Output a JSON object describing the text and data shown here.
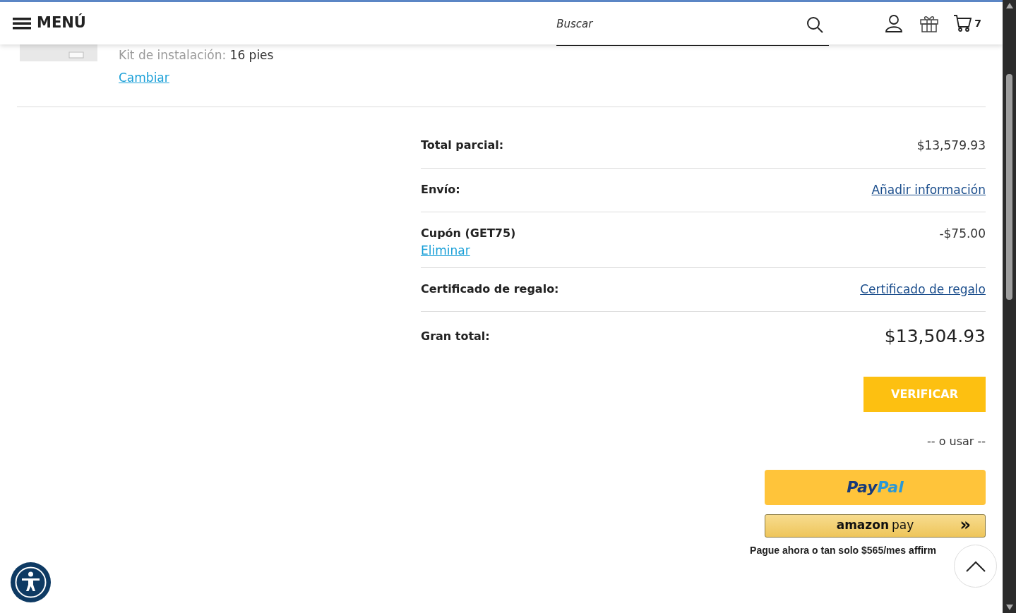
{
  "header": {
    "menu_label": "MENÚ",
    "search": {
      "placeholder": "Buscar"
    },
    "cart_count": "7"
  },
  "product": {
    "option_label": "Kit de instalación:",
    "option_value": "16 pies",
    "change_link": "Cambiar"
  },
  "summary": [
    {
      "kind": "amount",
      "label": "Total parcial:",
      "value": "$13,579.93"
    },
    {
      "kind": "link",
      "label": "Envío:",
      "value": "Añadir información"
    },
    {
      "kind": "coupon",
      "label": "Cupón (GET75)",
      "value": "-$75.00",
      "action": "Eliminar"
    },
    {
      "kind": "link",
      "label": "Certificado de regalo:",
      "value": "Certificado de regalo"
    },
    {
      "kind": "total",
      "label": "Gran total:",
      "value": "$13,504.93"
    }
  ],
  "checkout_button": "VERIFICAR",
  "separator": "-- o usar --",
  "paypal": {
    "pay": "Pay",
    "pal": "Pal"
  },
  "amazon_pay": {
    "brand": "amazon",
    "pay": "pay",
    "arrows": "»"
  },
  "affirm": {
    "text": "Pague ahora o tan solo $565/mes",
    "brand": "affirm"
  }
}
